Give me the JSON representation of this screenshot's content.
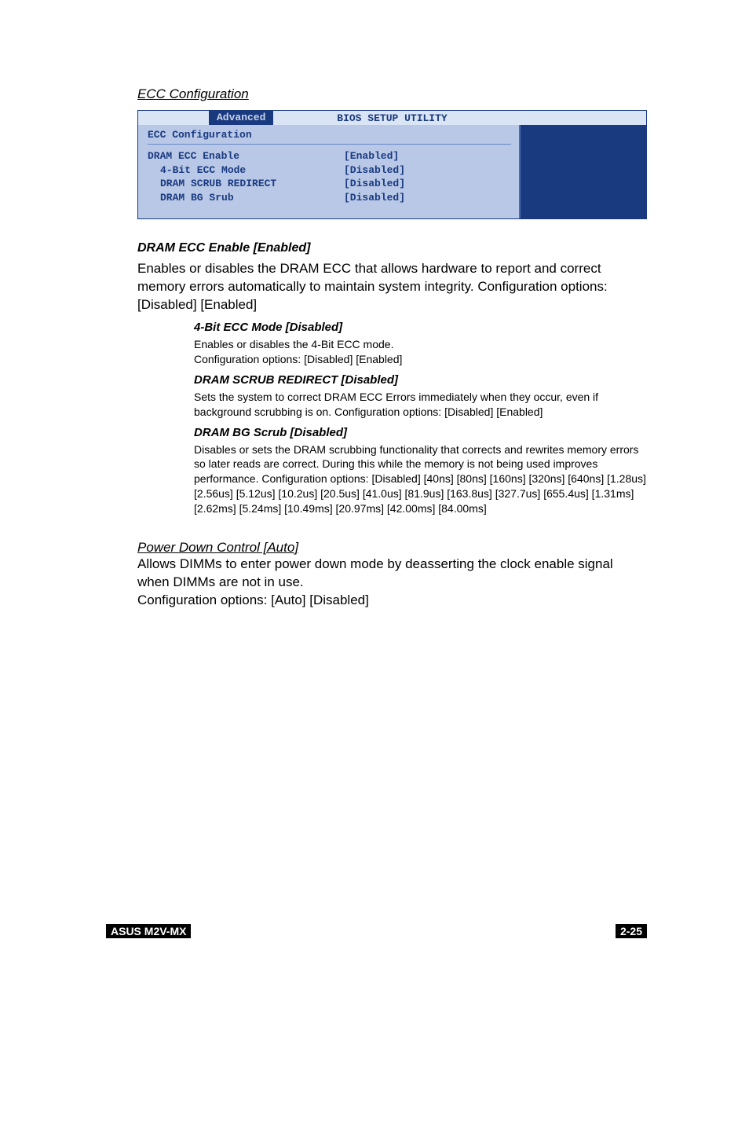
{
  "section1": {
    "title": "ECC Configuration"
  },
  "bios": {
    "title": "BIOS SETUP UTILITY",
    "tab": "Advanced",
    "section_label": "ECC Configuration",
    "rows": [
      {
        "label": "DRAM ECC Enable",
        "value": "[Enabled]",
        "indent": false
      },
      {
        "label": "4-Bit ECC Mode",
        "value": "[Disabled]",
        "indent": true
      },
      {
        "label": "DRAM SCRUB REDIRECT",
        "value": "[Disabled]",
        "indent": true
      },
      {
        "label": "DRAM BG Srub",
        "value": "[Disabled]",
        "indent": true
      }
    ]
  },
  "s1": {
    "heading": "DRAM ECC Enable [Enabled]",
    "body": "Enables or disables the DRAM ECC that allows hardware to report and correct memory errors automatically to maintain system integrity. Configuration options: [Disabled] [Enabled]"
  },
  "s2": {
    "heading": "4-Bit ECC Mode [Disabled]",
    "body": "Enables or disables the 4-Bit ECC mode.\nConfiguration options: [Disabled] [Enabled]"
  },
  "s3": {
    "heading": "DRAM SCRUB REDIRECT [Disabled]",
    "body": "Sets the system to correct DRAM ECC Errors immediately when they occur, even if background scrubbing is on. Configuration options: [Disabled] [Enabled]"
  },
  "s4": {
    "heading": "DRAM BG Scrub [Disabled]",
    "body": "Disables or sets the DRAM scrubbing functionality that corrects and rewrites memory errors so later reads are correct. During this while the memory is not being used improves performance. Configuration options: [Disabled] [40ns] [80ns] [160ns] [320ns] [640ns] [1.28us] [2.56us] [5.12us] [10.2us] [20.5us] [41.0us] [81.9us] [163.8us] [327.7us] [655.4us] [1.31ms] [2.62ms] [5.24ms] [10.49ms] [20.97ms] [42.00ms] [84.00ms]"
  },
  "power": {
    "title": "Power Down Control [Auto]",
    "body": "Allows DIMMs to enter power down mode by deasserting the clock enable signal when DIMMs are not in use.\nConfiguration options: [Auto] [Disabled]"
  },
  "footer": {
    "left": "ASUS M2V-MX",
    "right": "2-25"
  }
}
